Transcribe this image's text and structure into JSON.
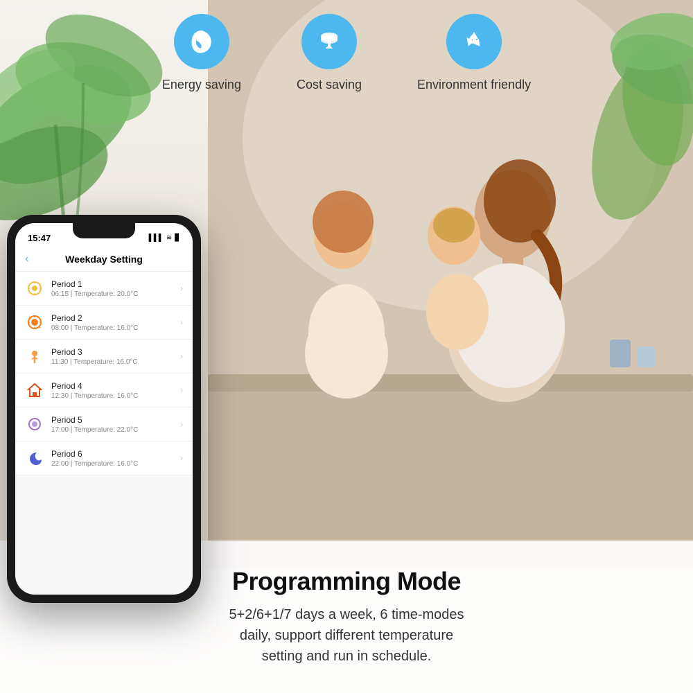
{
  "background": {
    "color": "#f0ede8"
  },
  "features": [
    {
      "id": "energy-saving",
      "label": "Energy saving",
      "icon": "leaf"
    },
    {
      "id": "cost-saving",
      "label": "Cost saving",
      "icon": "coins"
    },
    {
      "id": "environment-friendly",
      "label": "Environment friendly",
      "icon": "recycle"
    }
  ],
  "phone": {
    "statusBar": {
      "time": "15:47",
      "icons": "▌▌ ≋ ▶"
    },
    "header": {
      "backLabel": "‹",
      "title": "Weekday Setting"
    },
    "periods": [
      {
        "id": 1,
        "name": "Period 1",
        "time": "06:15",
        "temperature": "20.0°C",
        "iconEmoji": "🌤"
      },
      {
        "id": 2,
        "name": "Period 2",
        "time": "08:00",
        "temperature": "16.0°C",
        "iconEmoji": "☀"
      },
      {
        "id": 3,
        "name": "Period 3",
        "time": "11:30",
        "temperature": "16.0°C",
        "iconEmoji": "🧒"
      },
      {
        "id": 4,
        "name": "Period 4",
        "time": "12:30",
        "temperature": "16.0°C",
        "iconEmoji": "🏠"
      },
      {
        "id": 5,
        "name": "Period 5",
        "time": "17:00",
        "temperature": "22.0°C",
        "iconEmoji": "🌆"
      },
      {
        "id": 6,
        "name": "Period 6",
        "time": "22:00",
        "temperature": "16.0°C",
        "iconEmoji": "🌙"
      }
    ]
  },
  "bottomSection": {
    "title": "Programming Mode",
    "description": "5+2/6+1/7 days a week, 6 time-modes\ndaily, support different temperature\nsetting and run in schedule."
  }
}
